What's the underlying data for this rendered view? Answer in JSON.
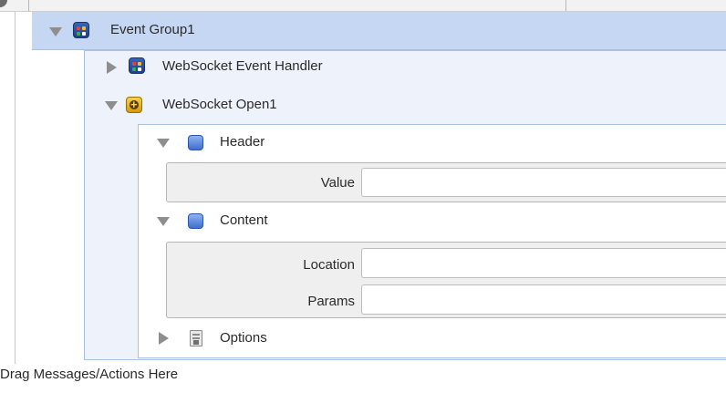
{
  "tree": {
    "group": {
      "label": "Event Group1"
    },
    "handler": {
      "label": "WebSocket Event Handler"
    },
    "open": {
      "label": "WebSocket Open1"
    },
    "header": {
      "label": "Header",
      "fields": [
        {
          "label": "Value",
          "value": ""
        }
      ]
    },
    "content": {
      "label": "Content",
      "fields": [
        {
          "label": "Location",
          "value": ""
        },
        {
          "label": "Params",
          "value": ""
        }
      ]
    },
    "options": {
      "label": "Options"
    }
  },
  "footer": {
    "drop_hint": "Drag Messages/Actions Here"
  },
  "colors": {
    "selected_row": "#c5d7f2",
    "group_container": "#eef3fb",
    "border_blue": "#a9c1e3",
    "field_panel": "#efefef"
  },
  "icons": {
    "group": "event-group-icon",
    "handler": "event-handler-icon",
    "open": "websocket-open-icon",
    "header": "header-icon",
    "content": "content-icon",
    "options": "options-icon"
  }
}
